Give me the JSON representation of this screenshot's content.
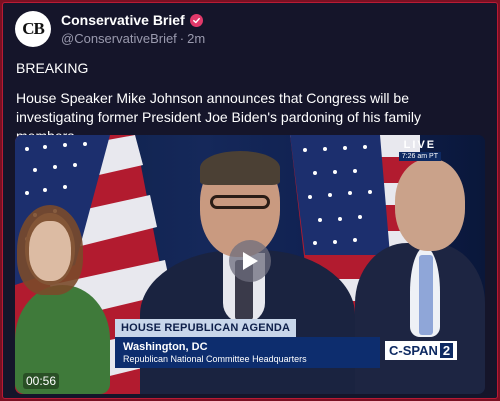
{
  "post": {
    "author_name": "Conservative Brief",
    "avatar_initials": "CB",
    "handle": "@ConservativeBrief",
    "time_ago": "2m",
    "text_line1": "BREAKING",
    "text_body": "House Speaker Mike Johnson announces that Congress will be investigating former President Joe Biden's pardoning of his family members."
  },
  "video": {
    "live_label": "LIVE",
    "live_time": "7:26 am PT",
    "lower_third_title": "HOUSE REPUBLICAN AGENDA",
    "lower_third_location": "Washington, DC",
    "lower_third_venue": "Republican National Committee Headquarters",
    "network_logo_text": "C-SPAN",
    "network_logo_num": "2",
    "duration": "00:56"
  },
  "colors": {
    "border": "#b81b35",
    "background": "#15152a",
    "verified_badge": "#e2396a",
    "muted_text": "#9a9aae"
  },
  "icons": {
    "verified": "verified-badge-icon",
    "play": "play-icon"
  }
}
